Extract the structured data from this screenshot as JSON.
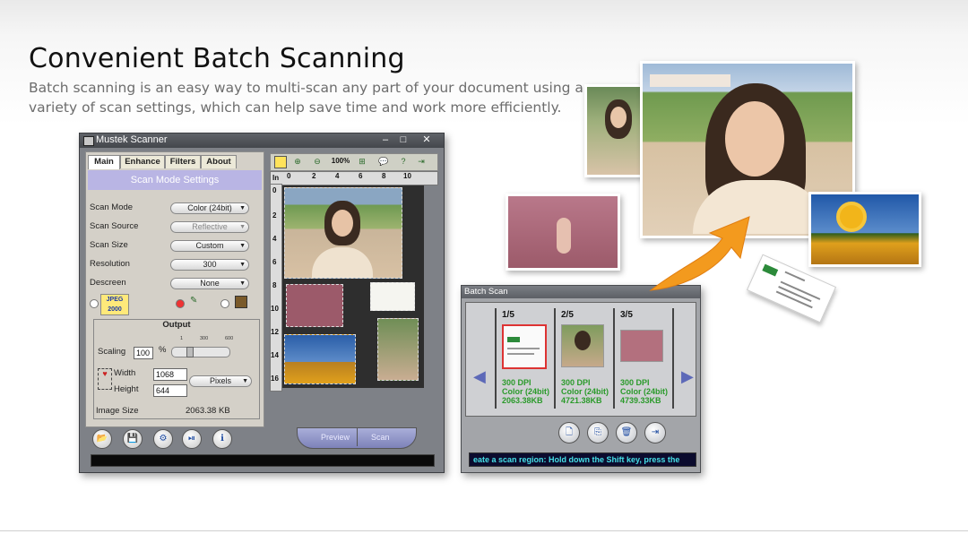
{
  "headline": "Convenient Batch Scanning",
  "subtitle": "Batch scanning is an easy way to multi-scan any part of your document using a variety of scan settings, which can help save time and work more efficiently.",
  "scanner_window": {
    "title": "Mustek Scanner",
    "tabs": [
      "Main",
      "Enhance",
      "Filters",
      "About"
    ],
    "panel_header": "Scan Mode Settings",
    "settings": [
      {
        "label": "Scan Mode",
        "value": "Color (24bit)",
        "enabled": true
      },
      {
        "label": "Scan Source",
        "value": "Reflective",
        "enabled": false
      },
      {
        "label": "Scan Size",
        "value": "Custom",
        "enabled": true
      },
      {
        "label": "Resolution",
        "value": "300",
        "enabled": true
      },
      {
        "label": "Descreen",
        "value": "None",
        "enabled": true
      }
    ],
    "jpeg_label": "JPEG 2000",
    "output": {
      "title": "Output",
      "scaling_label": "Scaling",
      "scaling_value": "100",
      "percent": "%",
      "ticks": [
        "1",
        "300",
        "600"
      ],
      "width_label": "Width",
      "width_value": "1068",
      "height_label": "Height",
      "height_value": "644",
      "unit": "Pixels"
    },
    "image_size_label": "Image Size",
    "image_size_value": "2063.38 KB",
    "zoom": "100%",
    "ruler_unit": "In",
    "ruler_h": [
      "0",
      "2",
      "4",
      "6",
      "8",
      "10"
    ],
    "ruler_v": [
      "0",
      "2",
      "4",
      "6",
      "8",
      "10",
      "12",
      "14",
      "16"
    ],
    "preview_button": "Preview",
    "scan_button": "Scan"
  },
  "batch_window": {
    "title": "Batch Scan",
    "items": [
      {
        "num": "1/5",
        "dpi": "300 DPI",
        "mode": "Color (24bit)",
        "size": "2063.38KB"
      },
      {
        "num": "2/5",
        "dpi": "300 DPI",
        "mode": "Color (24bit)",
        "size": "4721.38KB"
      },
      {
        "num": "3/5",
        "dpi": "300 DPI",
        "mode": "Color (24bit)",
        "size": "4739.33KB"
      }
    ],
    "status": "eate a scan region: Hold down the Shift key, press the"
  },
  "colors": {
    "accent_orange": "#f39a1e",
    "panel_header": "#b9b5e4",
    "info_green": "#2a9a2a",
    "status_cyan": "#46e0e8"
  }
}
